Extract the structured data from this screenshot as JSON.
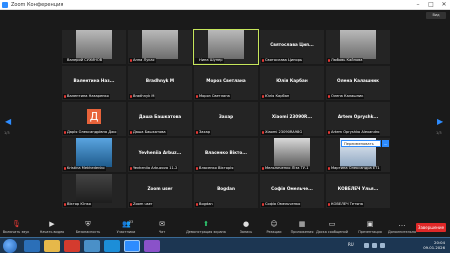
{
  "window": {
    "title": "Zoom Конференция",
    "view_button": "Вид"
  },
  "pager": {
    "left_page": "1/3",
    "right_page": "1/3"
  },
  "participants": [
    {
      "display": "",
      "label": "Валерий СУХИНОВ",
      "kind": "video",
      "muted": false
    },
    {
      "display": "",
      "label": "Анна Лукас",
      "kind": "video",
      "muted": true
    },
    {
      "display": "",
      "label": "Нина Шупер",
      "kind": "video",
      "muted": false,
      "speaking": true
    },
    {
      "display": "Святослава Цип...",
      "label": "Святослава Ципорь",
      "kind": "name",
      "muted": true
    },
    {
      "display": "",
      "label": "Любовь Кайнова",
      "kind": "video",
      "muted": true
    },
    {
      "display": "Валентина Наз...",
      "label": "Валентина Назаренко",
      "kind": "name",
      "muted": true
    },
    {
      "display": "Bradhnyk M",
      "label": "Bradhnyk M",
      "kind": "name",
      "muted": true
    },
    {
      "display": "Мороз Светлана",
      "label": "Мороз Светлана",
      "kind": "name",
      "muted": true
    },
    {
      "display": "Юлія Карбан",
      "label": "Юлія Карбан",
      "kind": "name",
      "muted": true
    },
    {
      "display": "Олена Калашник",
      "label": "Олена Калашник",
      "kind": "name",
      "muted": true
    },
    {
      "display": "",
      "label": "Дарія Олександрівна Джо",
      "kind": "avatar",
      "avatar_letter": "Д",
      "muted": true
    },
    {
      "display": "Даша Башкатова",
      "label": "Даша Башкатова",
      "kind": "name",
      "muted": true
    },
    {
      "display": "Захар",
      "label": "Захар",
      "kind": "name",
      "muted": true
    },
    {
      "display": "Xiaomi 23090R...",
      "label": "Xiaomi 23090RA98G",
      "kind": "name",
      "muted": true
    },
    {
      "display": "Artem Opryshk...",
      "label": "Artem Opryshko Alexandro",
      "kind": "name",
      "muted": true
    },
    {
      "display": "",
      "label": "Kristina Mekhedenko",
      "kind": "photo-sky",
      "muted": true
    },
    {
      "display": "Yevheniia Arbuz...",
      "label": "Yevheniia Arbuzova 11-2",
      "kind": "name",
      "muted": true
    },
    {
      "display": "Власенко Вікто...",
      "label": "Власенко Вікторія",
      "kind": "name",
      "muted": true
    },
    {
      "display": "",
      "label": "Мельниченко Ліза ТУ-1",
      "kind": "photo-face",
      "muted": true
    },
    {
      "display": "",
      "label": "Мартина Олександра ЕТ1",
      "kind": "photo-winter",
      "muted": true
    },
    {
      "display": "",
      "label": "Віктор Юнко",
      "kind": "photo-dark",
      "muted": true
    },
    {
      "display": "Zoom user",
      "label": "Zoom user",
      "kind": "name",
      "muted": true
    },
    {
      "display": "Bogdan",
      "label": "Bogdan",
      "kind": "name",
      "muted": true
    },
    {
      "display": "Софія Омельче...",
      "label": "Софія Омельченко",
      "kind": "name",
      "muted": true
    },
    {
      "display": "КОВЕЛЕЧ Улья...",
      "label": "КОВЕЛЕЧ Тетяна",
      "kind": "name",
      "muted": true
    }
  ],
  "tooltip": {
    "text": "Переименовать",
    "close": "..."
  },
  "toolbar": {
    "items": [
      {
        "label": "Включить звук",
        "icon": "mic-off-icon"
      },
      {
        "label": "Начать видео",
        "icon": "video-off-icon"
      },
      {
        "label": "Безопасность",
        "icon": "shield-icon"
      },
      {
        "label": "Участники",
        "icon": "participants-icon",
        "count": "33"
      },
      {
        "label": "Чат",
        "icon": "chat-icon"
      },
      {
        "label": "Демонстрация экрана",
        "icon": "share-icon"
      },
      {
        "label": "Запись",
        "icon": "record-icon"
      },
      {
        "label": "Реакции",
        "icon": "smile-icon"
      },
      {
        "label": "Приложения",
        "icon": "apps-icon"
      },
      {
        "label": "Доска сообщений",
        "icon": "whiteboard-icon"
      },
      {
        "label": "Презентация",
        "icon": "presentation-icon"
      },
      {
        "label": "Дополнительно",
        "icon": "more-icon"
      }
    ],
    "end_label": "Завершение"
  },
  "taskbar": {
    "lang": "RU",
    "time": "20:04",
    "date": "09.01.2026"
  },
  "colors": {
    "accent": "#2d8cff",
    "speaking": "#c6e65b",
    "end": "#e02828",
    "taskbar": "#1c3652"
  }
}
